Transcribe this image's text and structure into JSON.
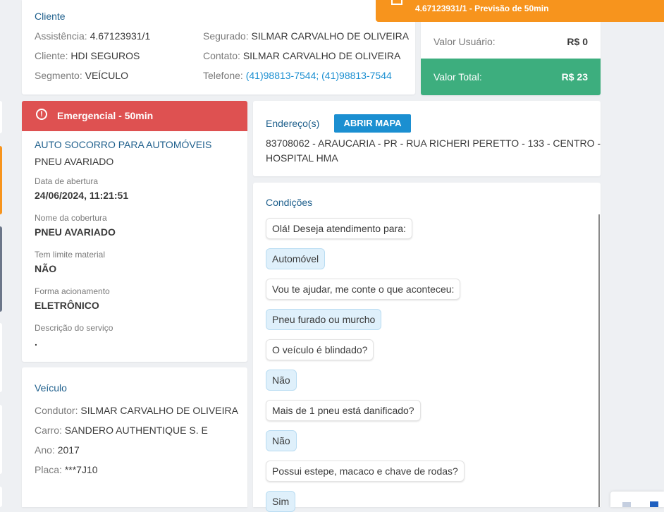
{
  "notification": {
    "text": "4.67123931/1 - Previsão de 50min",
    "icon": "calendar-icon"
  },
  "cliente": {
    "title": "Cliente",
    "left": [
      {
        "label": "Assistência:",
        "value": "4.67123931/1"
      },
      {
        "label": "Cliente:",
        "value": "HDI SEGUROS"
      },
      {
        "label": "Segmento:",
        "value": "VEÍCULO"
      }
    ],
    "right": [
      {
        "label": "Segurado:",
        "value": "SILMAR CARVALHO DE OLIVEIRA"
      },
      {
        "label": "Contato:",
        "value": "SILMAR CARVALHO DE OLIVEIRA"
      },
      {
        "label": "Telefone:",
        "value": "(41)98813-7544; (41)98813-7544"
      }
    ]
  },
  "valores": {
    "usuario_label": "Valor Usuário:",
    "usuario_value": "R$ 0",
    "total_label": "Valor Total:",
    "total_value": "R$ 23"
  },
  "servico": {
    "banner": "Emergencial - 50min",
    "banner_icon": "info-icon",
    "tipo": "AUTO SOCORRO PARA AUTOMÓVEIS",
    "subtipo": "PNEU AVARIADO",
    "fields": [
      {
        "label": "Data de abertura",
        "value": "24/06/2024, 11:21:51"
      },
      {
        "label": "Nome da cobertura",
        "value": "PNEU AVARIADO"
      },
      {
        "label": "Tem limite material",
        "value": "NÃO"
      },
      {
        "label": "Forma acionamento",
        "value": "ELETRÔNICO"
      },
      {
        "label": "Descrição do serviço",
        "value": "."
      }
    ]
  },
  "endereco": {
    "title": "Endereço(s)",
    "button": "ABRIR MAPA",
    "line1": "83708062 - ARAUCARIA - PR - RUA RICHERI PERETTO - 133 - CENTRO -",
    "line2": "HOSPITAL HMA"
  },
  "veiculo": {
    "title": "Veículo",
    "rows": [
      {
        "label": "Condutor:",
        "value": "SILMAR CARVALHO DE OLIVEIRA"
      },
      {
        "label": "Carro:",
        "value": "SANDERO AUTHENTIQUE S. E"
      },
      {
        "label": "Ano:",
        "value": "2017"
      },
      {
        "label": "Placa:",
        "value": "***7J10"
      }
    ]
  },
  "condicoes": {
    "title": "Condições",
    "messages": [
      {
        "from": "bot",
        "text": "Olá! Deseja atendimento para:"
      },
      {
        "from": "user",
        "text": "Automóvel"
      },
      {
        "from": "bot",
        "text": "Vou te ajudar, me conte o que aconteceu:"
      },
      {
        "from": "user",
        "text": "Pneu furado ou murcho"
      },
      {
        "from": "bot",
        "text": "O veículo é blindado?"
      },
      {
        "from": "user",
        "text": "Não"
      },
      {
        "from": "bot",
        "text": "Mais de 1 pneu está danificado?"
      },
      {
        "from": "user",
        "text": "Não"
      },
      {
        "from": "bot",
        "text": "Possui estepe, macaco e chave de rodas?"
      },
      {
        "from": "user",
        "text": "Sim"
      }
    ]
  },
  "colors": {
    "accent": "#1e5f8c",
    "link": "#1b8fd1",
    "danger": "#de5151",
    "success": "#3dae7e",
    "warning": "#f7941d"
  }
}
